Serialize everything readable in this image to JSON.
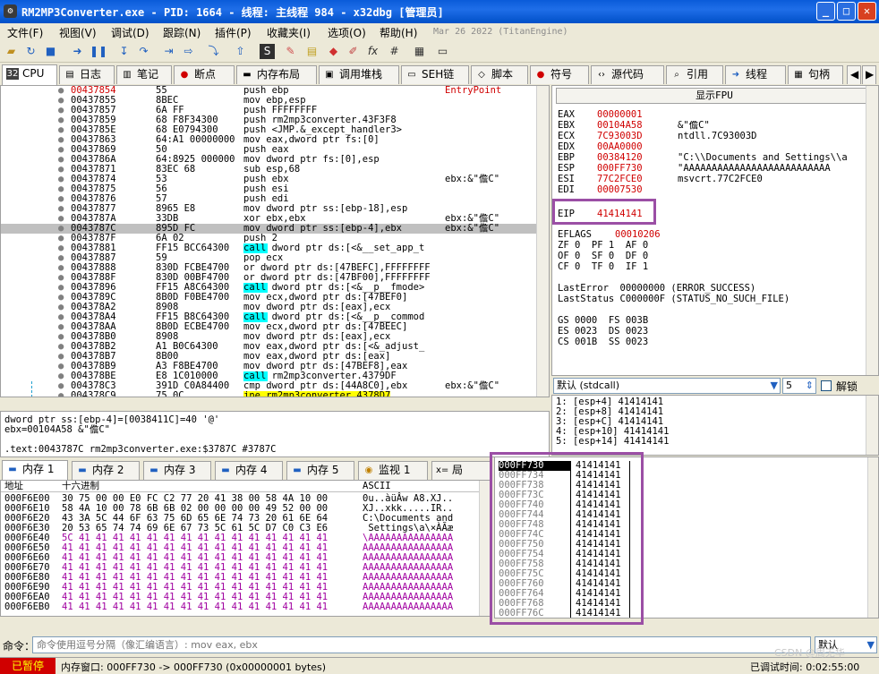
{
  "title": "RM2MP3Converter.exe - PID: 1664 - 线程: 主线程 984 - x32dbg [管理员]",
  "menu": [
    "文件(F)",
    "视图(V)",
    "调试(D)",
    "跟踪(N)",
    "插件(P)",
    "收藏夹(I)",
    "选项(O)",
    "帮助(H)"
  ],
  "build_date": "Mar 26 2022 (TitanEngine)",
  "tabs": [
    "CPU",
    "日志",
    "笔记",
    "断点",
    "内存布局",
    "调用堆栈",
    "SEH链",
    "脚本",
    "符号",
    "源代码",
    "引用",
    "线程",
    "句柄"
  ],
  "disasm": [
    {
      "a": "00437854",
      "b": "55",
      "i": "push ebp",
      "c": "EntryPoint"
    },
    {
      "a": "00437855",
      "b": "8BEC",
      "i": "mov ebp,esp",
      "c": ""
    },
    {
      "a": "00437857",
      "b": "6A FF",
      "i": "push FFFFFFFF",
      "c": ""
    },
    {
      "a": "00437859",
      "b": "68 F8F34300",
      "i": "push rm2mp3converter.43F3F8",
      "c": ""
    },
    {
      "a": "0043785E",
      "b": "68 E0794300",
      "i": "push <JMP.&_except_handler3>",
      "c": ""
    },
    {
      "a": "00437863",
      "b": "64:A1 00000000",
      "i": "mov eax,dword ptr fs:[0]",
      "c": ""
    },
    {
      "a": "00437869",
      "b": "50",
      "i": "push eax",
      "c": ""
    },
    {
      "a": "0043786A",
      "b": "64:8925 000000",
      "i": "mov dword ptr fs:[0],esp",
      "c": ""
    },
    {
      "a": "00437871",
      "b": "83EC 68",
      "i": "sub esp,68",
      "c": ""
    },
    {
      "a": "00437874",
      "b": "53",
      "i": "push ebx",
      "c": "ebx:&\"儋C\""
    },
    {
      "a": "00437875",
      "b": "56",
      "i": "push esi",
      "c": ""
    },
    {
      "a": "00437876",
      "b": "57",
      "i": "push edi",
      "c": ""
    },
    {
      "a": "00437877",
      "b": "8965 E8",
      "i": "mov dword ptr ss:[ebp-18],esp",
      "c": ""
    },
    {
      "a": "0043787A",
      "b": "33DB",
      "i": "xor ebx,ebx",
      "c": "ebx:&\"儋C\""
    },
    {
      "a": "0043787C",
      "b": "895D FC",
      "i": "mov dword ptr ss:[ebp-4],ebx",
      "c": "ebx:&\"儋C\""
    },
    {
      "a": "0043787F",
      "b": "6A 02",
      "i": "push 2",
      "c": ""
    },
    {
      "a": "00437881",
      "b": "FF15 BCC64300",
      "i": "call dword ptr ds:[<&__set_app_t",
      "c": ""
    },
    {
      "a": "00437887",
      "b": "59",
      "i": "pop ecx",
      "c": ""
    },
    {
      "a": "00437888",
      "b": "830D FCBE4700",
      "i": "or dword ptr ds:[47BEFC],FFFFFFFF",
      "c": ""
    },
    {
      "a": "0043788F",
      "b": "830D 00BF4700",
      "i": "or dword ptr ds:[47BF00],FFFFFFFF",
      "c": ""
    },
    {
      "a": "00437896",
      "b": "FF15 A8C64300",
      "i": "call dword ptr ds:[<&__p__fmode>",
      "c": ""
    },
    {
      "a": "0043789C",
      "b": "8B0D F0BE4700",
      "i": "mov ecx,dword ptr ds:[47BEF0]",
      "c": ""
    },
    {
      "a": "004378A2",
      "b": "8908",
      "i": "mov dword ptr ds:[eax],ecx",
      "c": ""
    },
    {
      "a": "004378A4",
      "b": "FF15 B8C64300",
      "i": "call dword ptr ds:[<&__p__commod",
      "c": ""
    },
    {
      "a": "004378AA",
      "b": "8B0D ECBE4700",
      "i": "mov ecx,dword ptr ds:[47BEEC]",
      "c": ""
    },
    {
      "a": "004378B0",
      "b": "8908",
      "i": "mov dword ptr ds:[eax],ecx",
      "c": ""
    },
    {
      "a": "004378B2",
      "b": "A1 B0C64300",
      "i": "mov eax,dword ptr ds:[<&_adjust_",
      "c": ""
    },
    {
      "a": "004378B7",
      "b": "8B00",
      "i": "mov eax,dword ptr ds:[eax]",
      "c": ""
    },
    {
      "a": "004378B9",
      "b": "A3 F8BE4700",
      "i": "mov dword ptr ds:[47BEF8],eax",
      "c": ""
    },
    {
      "a": "004378BE",
      "b": "E8 1C010000",
      "i": "call rm2mp3converter.4379DF",
      "c": ""
    },
    {
      "a": "004378C3",
      "b": "391D C0A84400",
      "i": "cmp dword ptr ds:[44A8C0],ebx",
      "c": "ebx:&\"儋C\""
    },
    {
      "a": "004378C9",
      "b": "75 0C",
      "i": "jne rm2mp3converter.4378D7",
      "c": ""
    }
  ],
  "fpu_button": "显示FPU",
  "registers": [
    {
      "n": "EAX",
      "v": "00000001",
      "c": ""
    },
    {
      "n": "EBX",
      "v": "00104A58",
      "c": "&\"儋C\""
    },
    {
      "n": "ECX",
      "v": "7C93003D",
      "c": "ntdll.7C93003D"
    },
    {
      "n": "EDX",
      "v": "00AA0000",
      "c": ""
    },
    {
      "n": "EBP",
      "v": "00384120",
      "c": "\"C:\\\\Documents and Settings\\\\a"
    },
    {
      "n": "ESP",
      "v": "000FF730",
      "c": "\"AAAAAAAAAAAAAAAAAAAAAAAAAA"
    },
    {
      "n": "ESI",
      "v": "77C2FCE0",
      "c": "msvcrt.77C2FCE0"
    },
    {
      "n": "EDI",
      "v": "00007530",
      "c": ""
    }
  ],
  "eip": {
    "n": "EIP",
    "v": "41414141"
  },
  "eflags": {
    "n": "EFLAGS",
    "v": "00010206"
  },
  "flags": [
    "ZF 0  PF 1  AF 0",
    "OF 0  SF 0  DF 0",
    "CF 0  TF 0  IF 1"
  ],
  "last_error": "LastError  00000000 (ERROR_SUCCESS)",
  "last_status": "LastStatus C000000F (STATUS_NO_SUCH_FILE)",
  "segs": [
    "GS 0000  FS 003B",
    "ES 0023  DS 0023",
    "CS 001B  SS 0023"
  ],
  "callconv": "默认 (stdcall)",
  "argcount": "5",
  "unlock": "解锁",
  "stack_args": [
    "1: [esp+4] 41414141",
    "2: [esp+8] 41414141",
    "3: [esp+C] 41414141",
    "4: [esp+10] 41414141",
    "5: [esp+14] 41414141"
  ],
  "info_lines": [
    "dword ptr ss:[ebp-4]=[0038411C]=40 '@'",
    "ebx=00104A58 &\"儋C\"",
    "",
    ".text:0043787C rm2mp3converter.exe:$3787C #3787C"
  ],
  "dump_tabs": [
    "内存 1",
    "内存 2",
    "内存 3",
    "内存 4",
    "内存 5",
    "监视 1",
    "局"
  ],
  "dump_headers": [
    "地址",
    "十六进制",
    "ASCII"
  ],
  "dump": [
    {
      "a": "000F6E00",
      "h": "30 75 00 00 E0 FC C2 77 20 41 38 00 58 4A 10 00",
      "s": "0u..àüÂw A8.XJ.."
    },
    {
      "a": "000F6E10",
      "h": "58 4A 10 00 78 6B 6B 02 00 00 00 00 49 52 00 00",
      "s": "XJ..xkk.....IR.."
    },
    {
      "a": "000F6E20",
      "h": "43 3A 5C 44 6F 63 75 6D 65 6E 74 73 20 61 6E 64",
      "s": "C:\\Documents and"
    },
    {
      "a": "000F6E30",
      "h": "20 53 65 74 74 69 6E 67 73 5C 61 5C D7 C0 C3 E6",
      "s": " Settings\\a\\×ÀÃæ"
    },
    {
      "a": "000F6E40",
      "h": "5C 41 41 41 41 41 41 41 41 41 41 41 41 41 41 41",
      "s": "\\AAAAAAAAAAAAAAA"
    },
    {
      "a": "000F6E50",
      "h": "41 41 41 41 41 41 41 41 41 41 41 41 41 41 41 41",
      "s": "AAAAAAAAAAAAAAAA"
    },
    {
      "a": "000F6E60",
      "h": "41 41 41 41 41 41 41 41 41 41 41 41 41 41 41 41",
      "s": "AAAAAAAAAAAAAAAA"
    },
    {
      "a": "000F6E70",
      "h": "41 41 41 41 41 41 41 41 41 41 41 41 41 41 41 41",
      "s": "AAAAAAAAAAAAAAAA"
    },
    {
      "a": "000F6E80",
      "h": "41 41 41 41 41 41 41 41 41 41 41 41 41 41 41 41",
      "s": "AAAAAAAAAAAAAAAA"
    },
    {
      "a": "000F6E90",
      "h": "41 41 41 41 41 41 41 41 41 41 41 41 41 41 41 41",
      "s": "AAAAAAAAAAAAAAAA"
    },
    {
      "a": "000F6EA0",
      "h": "41 41 41 41 41 41 41 41 41 41 41 41 41 41 41 41",
      "s": "AAAAAAAAAAAAAAAA"
    },
    {
      "a": "000F6EB0",
      "h": "41 41 41 41 41 41 41 41 41 41 41 41 41 41 41 41",
      "s": "AAAAAAAAAAAAAAAA"
    }
  ],
  "stack_mem": [
    {
      "a": "000FF730",
      "v": "41414141"
    },
    {
      "a": "000FF734",
      "v": "41414141"
    },
    {
      "a": "000FF738",
      "v": "41414141"
    },
    {
      "a": "000FF73C",
      "v": "41414141"
    },
    {
      "a": "000FF740",
      "v": "41414141"
    },
    {
      "a": "000FF744",
      "v": "41414141"
    },
    {
      "a": "000FF748",
      "v": "41414141"
    },
    {
      "a": "000FF74C",
      "v": "41414141"
    },
    {
      "a": "000FF750",
      "v": "41414141"
    },
    {
      "a": "000FF754",
      "v": "41414141"
    },
    {
      "a": "000FF758",
      "v": "41414141"
    },
    {
      "a": "000FF75C",
      "v": "41414141"
    },
    {
      "a": "000FF760",
      "v": "41414141"
    },
    {
      "a": "000FF764",
      "v": "41414141"
    },
    {
      "a": "000FF768",
      "v": "41414141"
    },
    {
      "a": "000FF76C",
      "v": "41414141"
    }
  ],
  "cmd_label": "命令：",
  "cmd_placeholder": "命令使用逗号分隔（像汇编语言）: mov eax, ebx",
  "cmd_mode": "默认",
  "status_state": "已暂停",
  "status_msg": "内存窗口: 000FF730 -> 000FF730 (0x00000001 bytes)",
  "status_time": "已调试时间: 0:02:55:00",
  "watermark": "CSDN @周无华"
}
